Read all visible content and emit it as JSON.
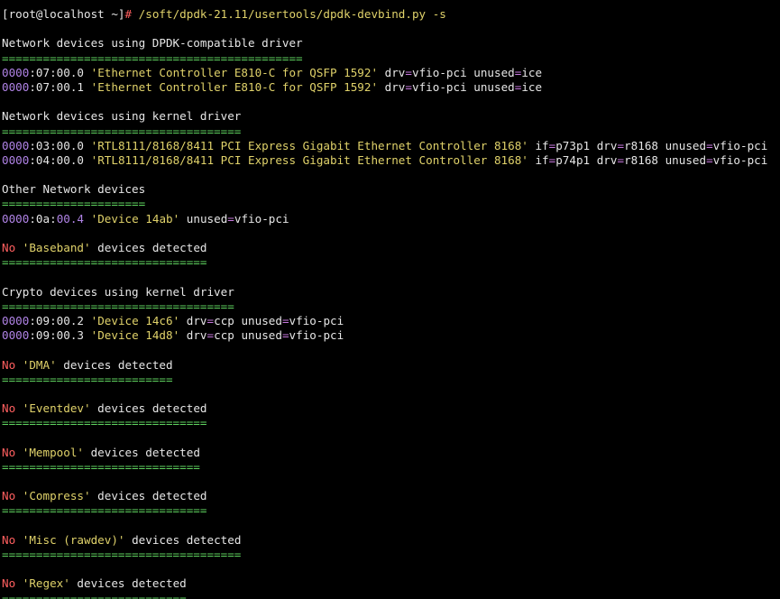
{
  "prompt": {
    "user_host": "[root@localhost ~]",
    "hash": "#",
    "command": " /soft/dpdk-21.11/usertools/dpdk-devbind.py -s"
  },
  "sections": {
    "dpdk": {
      "title": "Network devices using DPDK-compatible driver",
      "sep": "============================================",
      "devices": [
        {
          "dom": "0000",
          "rest": ":07:00.0",
          "name": "'Ethernet Controller E810-C for QSFP 1592'",
          "k1": " drv",
          "v1": "vfio-pci",
          "k2": " unused",
          "v2": "ice"
        },
        {
          "dom": "0000",
          "rest": ":07:00.1",
          "name": "'Ethernet Controller E810-C for QSFP 1592'",
          "k1": " drv",
          "v1": "vfio-pci",
          "k2": " unused",
          "v2": "ice"
        }
      ]
    },
    "kernel": {
      "title": "Network devices using kernel driver",
      "sep": "===================================",
      "devices": [
        {
          "dom": "0000",
          "rest": ":03:00.0",
          "name": "'RTL8111/8168/8411 PCI Express Gigabit Ethernet Controller 8168'",
          "k0": " if",
          "v0": "p73p1",
          "k1": " drv",
          "v1": "r8168",
          "k2": " unused",
          "v2": "vfio-pci"
        },
        {
          "dom": "0000",
          "rest": ":04:00.0",
          "name": "'RTL8111/8168/8411 PCI Express Gigabit Ethernet Controller 8168'",
          "k0": " if",
          "v0": "p74p1",
          "k1": " drv",
          "v1": "r8168",
          "k2": " unused",
          "v2": "vfio-pci"
        }
      ]
    },
    "other": {
      "title": "Other Network devices",
      "sep": "=====================",
      "device": {
        "dom": "0000",
        "bus": ":0a",
        "colon": ":",
        "devfn": "00.4",
        "name": "'Device 14ab'",
        "k2": " unused",
        "v2": "vfio-pci"
      }
    },
    "baseband": {
      "no": "No",
      "name": "'Baseband'",
      "text": " devices detected",
      "sep": "=============================="
    },
    "crypto": {
      "title": "Crypto devices using kernel driver",
      "sep": "==================================",
      "devices": [
        {
          "dom": "0000",
          "rest": ":09:00.2",
          "name": "'Device 14c6'",
          "k1": " drv",
          "v1": "ccp",
          "k2": " unused",
          "v2": "vfio-pci"
        },
        {
          "dom": "0000",
          "rest": ":09:00.3",
          "name": "'Device 14d8'",
          "k1": " drv",
          "v1": "ccp",
          "k2": " unused",
          "v2": "vfio-pci"
        }
      ]
    },
    "dma": {
      "no": "No",
      "name": "'DMA'",
      "text": " devices detected",
      "sep": "========================="
    },
    "eventdev": {
      "no": "No",
      "name": "'Eventdev'",
      "text": " devices detected",
      "sep": "=============================="
    },
    "mempool": {
      "no": "No",
      "name": "'Mempool'",
      "text": " devices detected",
      "sep": "============================="
    },
    "compress": {
      "no": "No",
      "name": "'Compress'",
      "text": " devices detected",
      "sep": "=============================="
    },
    "misc": {
      "no": "No",
      "name": "'Misc (rawdev)'",
      "text": " devices detected",
      "sep": "==================================="
    },
    "regex": {
      "no": "No",
      "name": "'Regex'",
      "text": " devices detected",
      "sep": "==========================="
    }
  },
  "eq": "="
}
